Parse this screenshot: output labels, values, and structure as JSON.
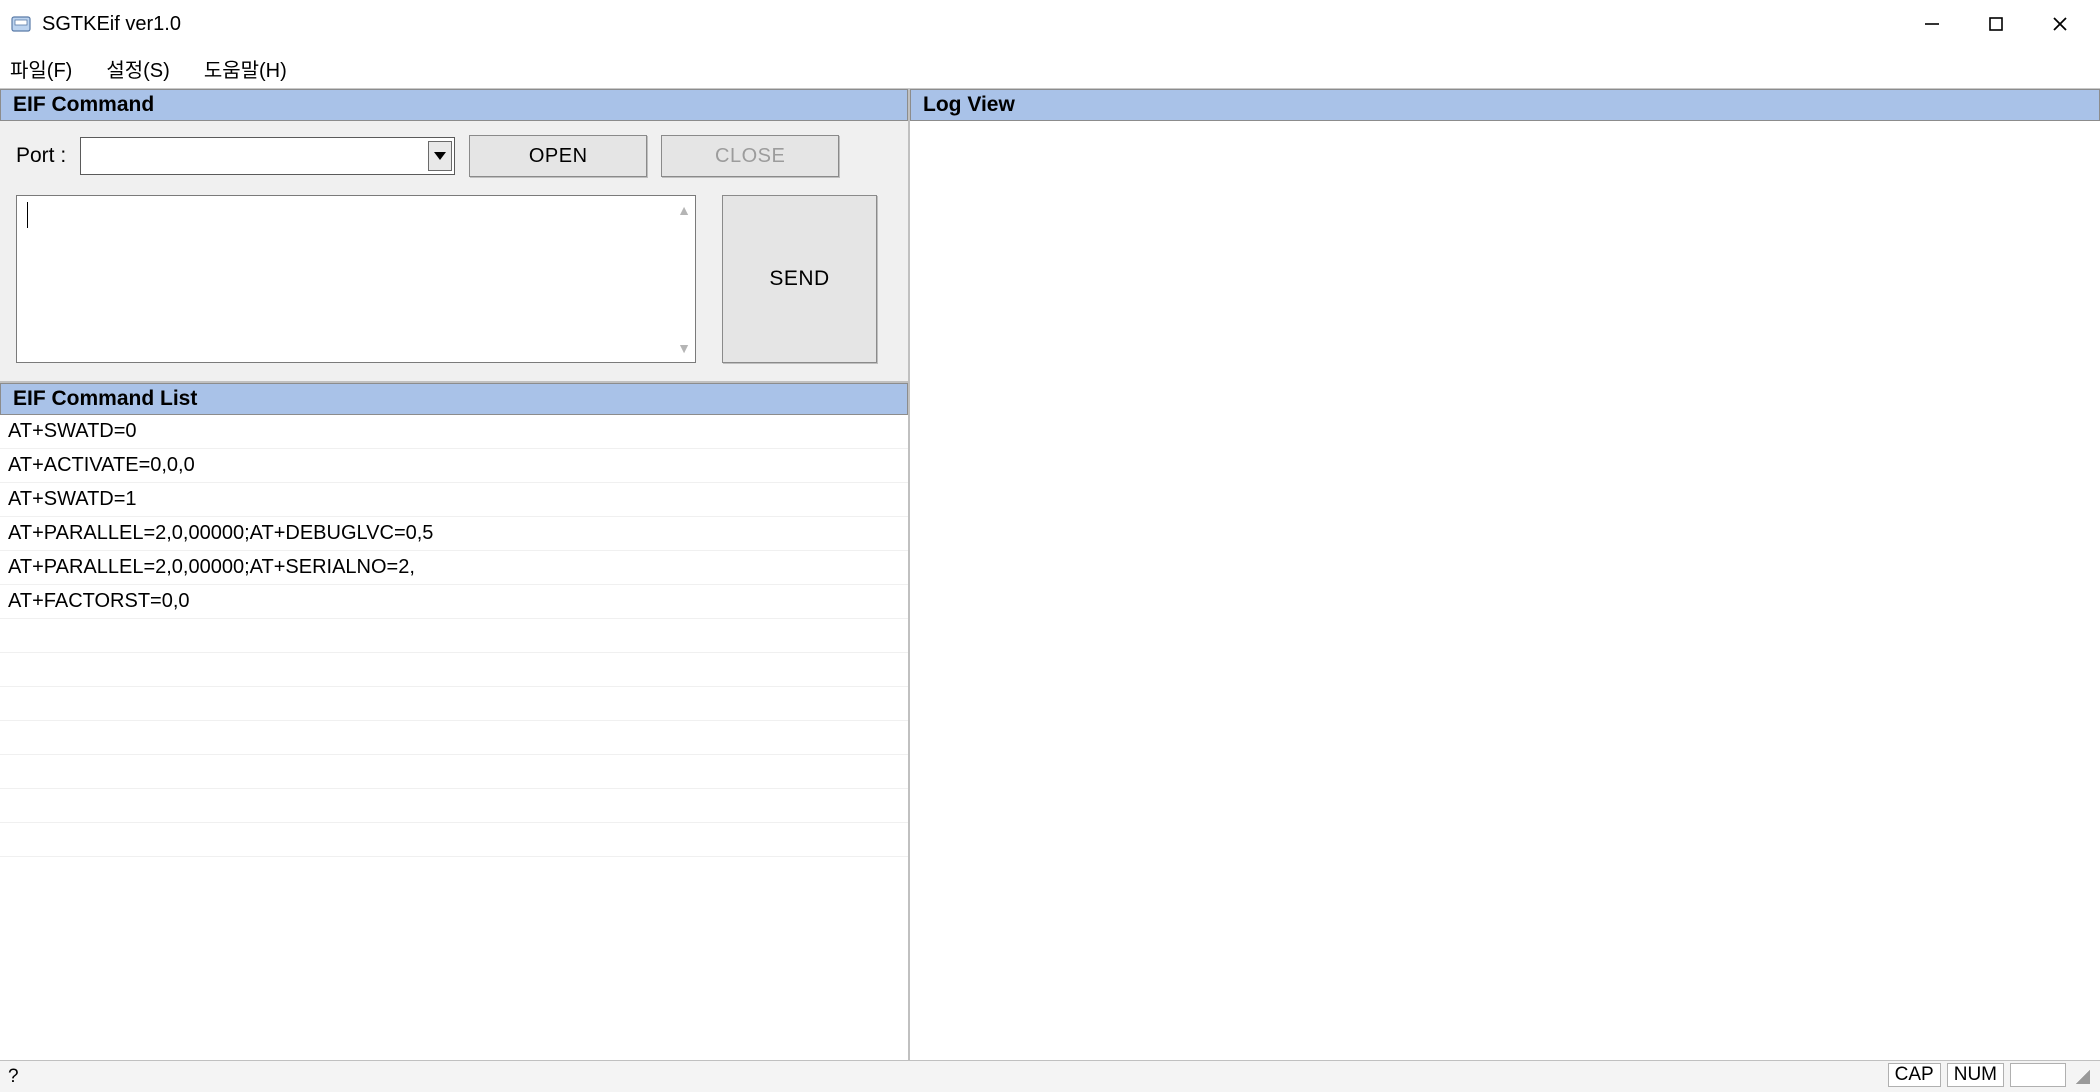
{
  "window": {
    "title": "SGTKEif ver1.0"
  },
  "menu": {
    "file": "파일(F)",
    "settings": "설정(S)",
    "help": "도움말(H)"
  },
  "panels": {
    "eif_command": "EIF Command",
    "eif_command_list": "EIF Command List",
    "log_view": "Log View"
  },
  "port": {
    "label": "Port :",
    "value": ""
  },
  "buttons": {
    "open": "OPEN",
    "close": "CLOSE",
    "send": "SEND"
  },
  "command_input": {
    "value": ""
  },
  "command_list": [
    "AT+SWATD=0",
    "AT+ACTIVATE=0,0,0",
    "AT+SWATD=1",
    "AT+PARALLEL=2,0,00000;AT+DEBUGLVC=0,5",
    "AT+PARALLEL=2,0,00000;AT+SERIALNO=2,",
    "AT+FACTORST=0,0"
  ],
  "status": {
    "left": "?",
    "cap": "CAP",
    "num": "NUM"
  }
}
